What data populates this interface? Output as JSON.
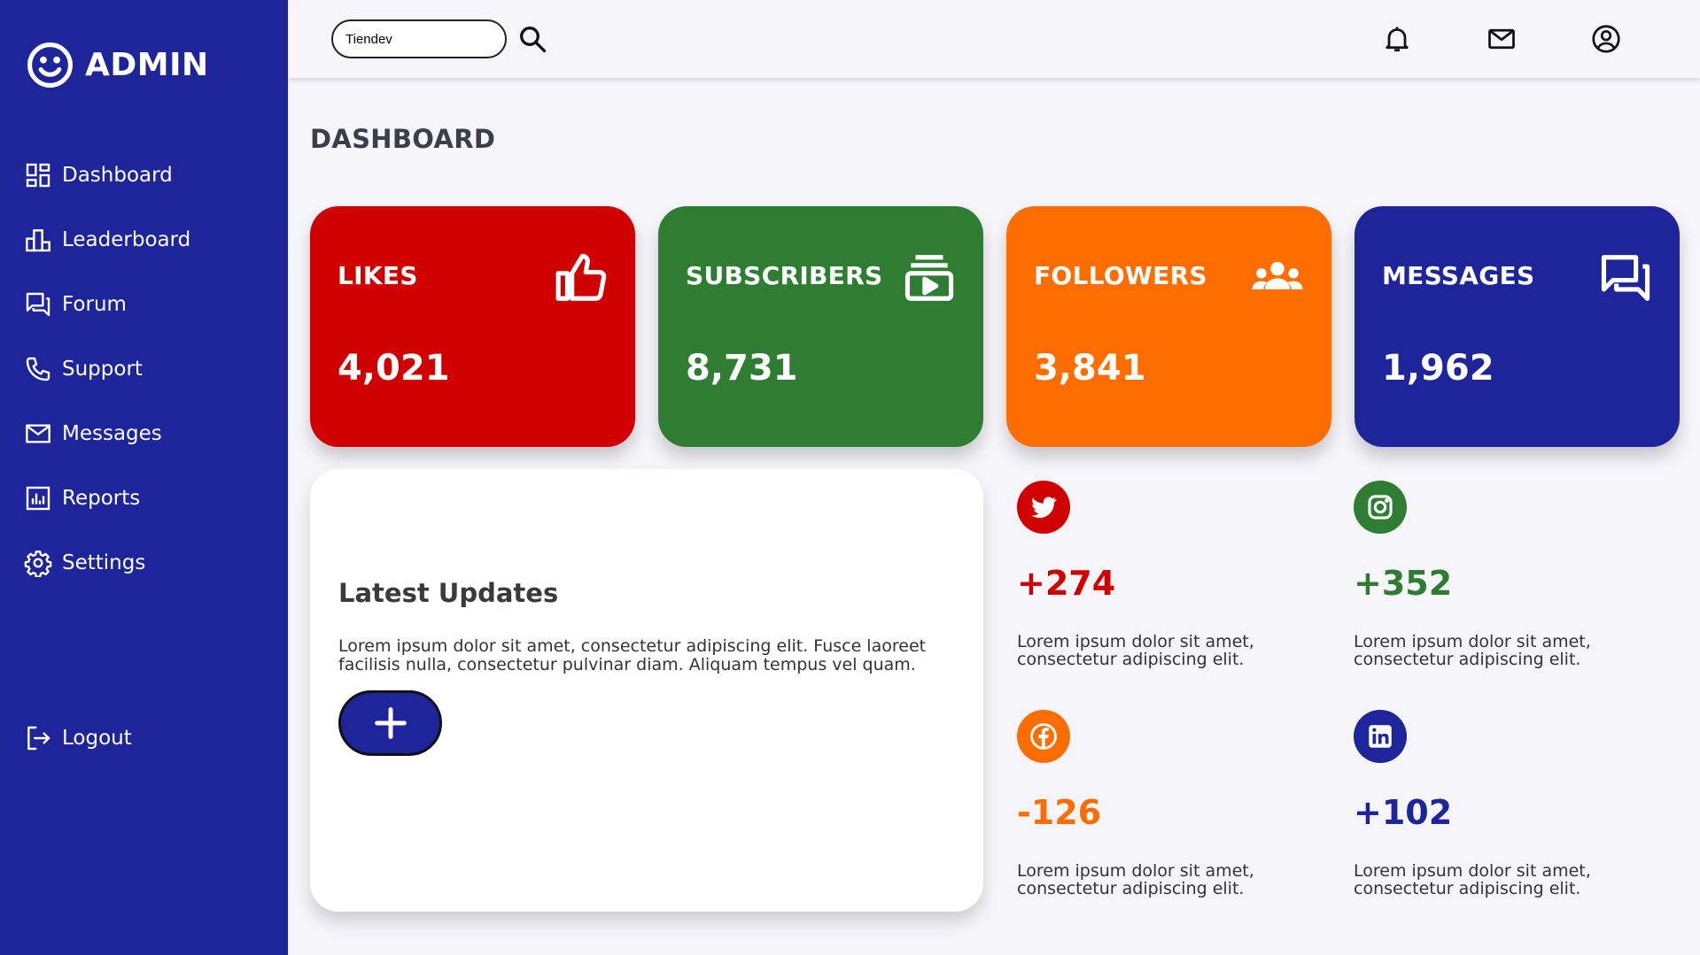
{
  "brand": {
    "name": "ADMIN",
    "icon": "smiley-icon"
  },
  "sidebar": {
    "items": [
      {
        "label": "Dashboard",
        "icon": "dashboard-icon"
      },
      {
        "label": "Leaderboard",
        "icon": "leaderboard-icon"
      },
      {
        "label": "Forum",
        "icon": "forum-icon"
      },
      {
        "label": "Support",
        "icon": "phone-icon"
      },
      {
        "label": "Messages",
        "icon": "mail-icon"
      },
      {
        "label": "Reports",
        "icon": "report-chart-icon"
      },
      {
        "label": "Settings",
        "icon": "gear-icon"
      }
    ],
    "logout": {
      "label": "Logout",
      "icon": "logout-icon"
    }
  },
  "topbar": {
    "search": {
      "value": "Tiendev",
      "icon": "search-icon"
    },
    "icons": [
      "bell-icon",
      "mail-icon",
      "user-circle-icon"
    ]
  },
  "main": {
    "title": "DASHBOARD",
    "stats": [
      {
        "label": "LIKES",
        "value": "4,021",
        "color": "#d10000",
        "icon": "thumbs-up-icon"
      },
      {
        "label": "SUBSCRIBERS",
        "value": "8,731",
        "color": "#2e7d32",
        "icon": "subscriptions-icon"
      },
      {
        "label": "FOLLOWERS",
        "value": "3,841",
        "color": "#ff6d00",
        "icon": "group-icon"
      },
      {
        "label": "MESSAGES",
        "value": "1,962",
        "color": "#1e2499",
        "icon": "chat-icon"
      }
    ],
    "updates": {
      "title": "Latest Updates",
      "text": "Lorem ipsum dolor sit amet, consectetur adipiscing elit. Fusce laoreet facilisis nulla, consectetur pulvinar diam. Aliquam tempus vel quam.",
      "button_icon": "plus-icon"
    },
    "social": [
      {
        "network": "twitter",
        "value": "+274",
        "text": "Lorem ipsum dolor sit amet, consectetur adipiscing elit.",
        "color": "#d10000",
        "icon": "twitter-icon"
      },
      {
        "network": "instagram",
        "value": "+352",
        "text": "Lorem ipsum dolor sit amet, consectetur adipiscing elit.",
        "color": "#2e7d32",
        "icon": "instagram-icon"
      },
      {
        "network": "facebook",
        "value": "-126",
        "text": "Lorem ipsum dolor sit amet, consectetur adipiscing elit.",
        "color": "#ff6d00",
        "icon": "facebook-icon"
      },
      {
        "network": "linkedin",
        "value": "+102",
        "text": "Lorem ipsum dolor sit amet, consectetur adipiscing elit.",
        "color": "#1e2499",
        "icon": "linkedin-icon"
      }
    ]
  }
}
